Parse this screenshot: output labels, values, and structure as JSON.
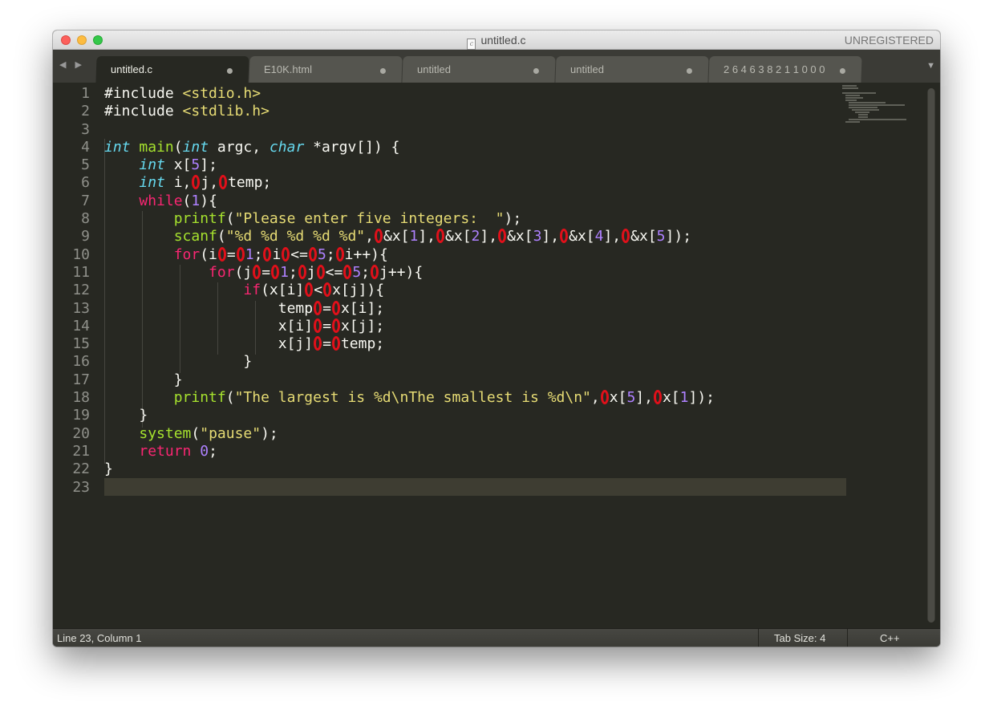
{
  "window": {
    "title": "untitled.c",
    "file_icon": "c",
    "unregistered": "UNREGISTERED"
  },
  "tabs": [
    {
      "label": "untitled.c",
      "active": true
    },
    {
      "label": "E10K.html",
      "active": false
    },
    {
      "label": "untitled",
      "active": false
    },
    {
      "label": "untitled",
      "active": false
    },
    {
      "label": "2 6 4 6 3 8 2 1 1 0 0 0",
      "active": false
    }
  ],
  "nav_arrows": "◀ ▶",
  "tab_overflow_icon": "▼",
  "line_numbers": [
    "1",
    "2",
    "3",
    "4",
    "5",
    "6",
    "7",
    "8",
    "9",
    "10",
    "11",
    "12",
    "13",
    "14",
    "15",
    "16",
    "17",
    "18",
    "19",
    "20",
    "21",
    "22",
    "23"
  ],
  "code": {
    "l1_include": "#include",
    "l1_header": "<stdio.h>",
    "l2_include": "#include",
    "l2_header": "<stdlib.h>",
    "l4_type1": "int",
    "l4_fn": "main",
    "l4_type2": "int",
    "l4_argc": " argc, ",
    "l4_type3": "char",
    "l4_argv": " *argv[]) {",
    "l5_type": "int",
    "l5_rest": " x[",
    "l5_num": "5",
    "l5_end": "];",
    "l6_type": "int",
    "l6_i": " i,",
    "l6_j": "j,",
    "l6_temp": "temp;",
    "l7_kw": "while",
    "l7_num": "1",
    "l8_fn": "printf",
    "l8_str": "\"Please enter five integers:  \"",
    "l9_fn": "scanf",
    "l9_str": "\"%d %d %d %d %d\"",
    "l10_kw": "for",
    "l11_kw": "for",
    "l12_kw": "if",
    "l13_code": "temp",
    "l14_code": "x[i]",
    "l15_code": "x[j]",
    "l18_fn": "printf",
    "l18_str": "\"The largest is %d\\nThe smallest is %d\\n\"",
    "l20_fn": "system",
    "l20_str": "\"pause\"",
    "l21_kw": "return",
    "l21_num": "0"
  },
  "status": {
    "position": "Line 23, Column 1",
    "tab_size": "Tab Size: 4",
    "syntax": "C++"
  },
  "colors": {
    "background": "#272822",
    "keyword": "#f92672",
    "type": "#66d9ef",
    "function": "#a6e22e",
    "string": "#e6db74",
    "number": "#ae81ff",
    "annotation": "#e0101a"
  }
}
